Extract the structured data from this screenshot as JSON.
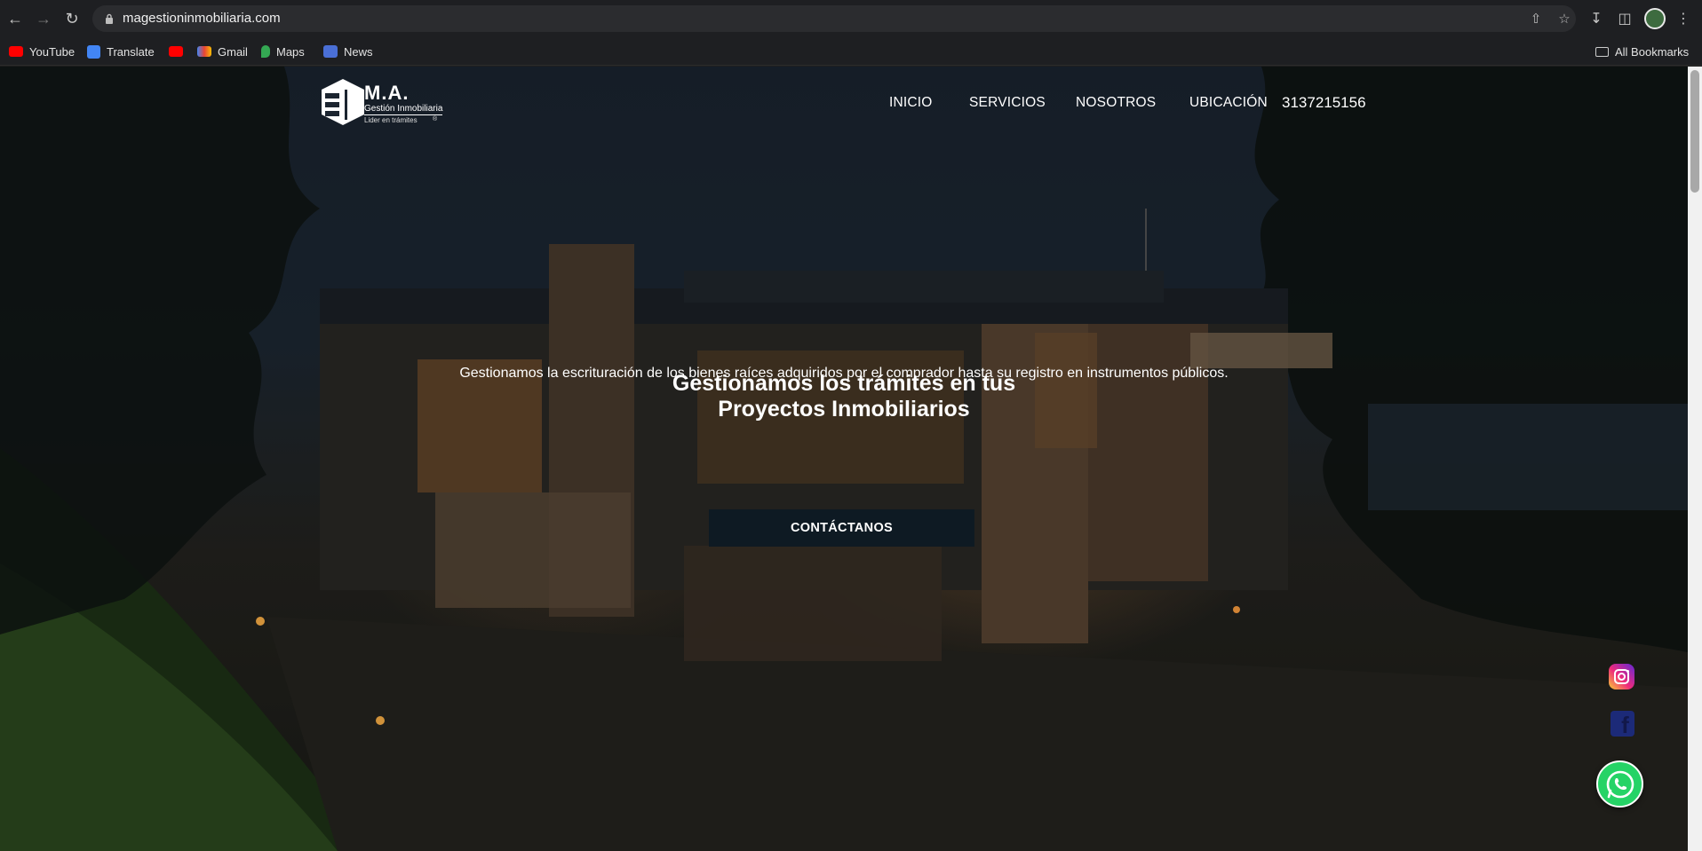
{
  "browser": {
    "url": "magestioninmobiliaria.com",
    "bookmarks": [
      {
        "label": "YouTube",
        "icon": "youtube-icon"
      },
      {
        "label": "Translate",
        "icon": "translate-icon"
      },
      {
        "label": "",
        "icon": "youtube-icon"
      },
      {
        "label": "Gmail",
        "icon": "gmail-icon"
      },
      {
        "label": "Maps",
        "icon": "maps-icon"
      },
      {
        "label": "News",
        "icon": "news-icon"
      }
    ],
    "all_bookmarks": "All Bookmarks"
  },
  "site": {
    "logo": {
      "title": "M.A.",
      "subtitle": "Gestión Inmobiliaria",
      "tagline": "Lider en trámites",
      "registered": "®"
    },
    "nav": [
      "INICIO",
      "SERVICIOS",
      "NOSOTROS",
      "UBICACIÓN"
    ],
    "phone": "3137215156",
    "hero": {
      "title_line1": "Gestionamos los trámites en tus",
      "title_line2": "Proyectos Inmobiliarios",
      "subtitle": "Gestionamos la escrituración de los bienes raíces adquiridos por el comprador hasta su registro en instrumentos públicos.",
      "cta": "CONTÁCTANOS"
    },
    "social": [
      "instagram-icon",
      "facebook-icon",
      "whatsapp-icon"
    ]
  },
  "colors": {
    "cta_bg": "#0e1a23",
    "whatsapp": "#25d366"
  }
}
